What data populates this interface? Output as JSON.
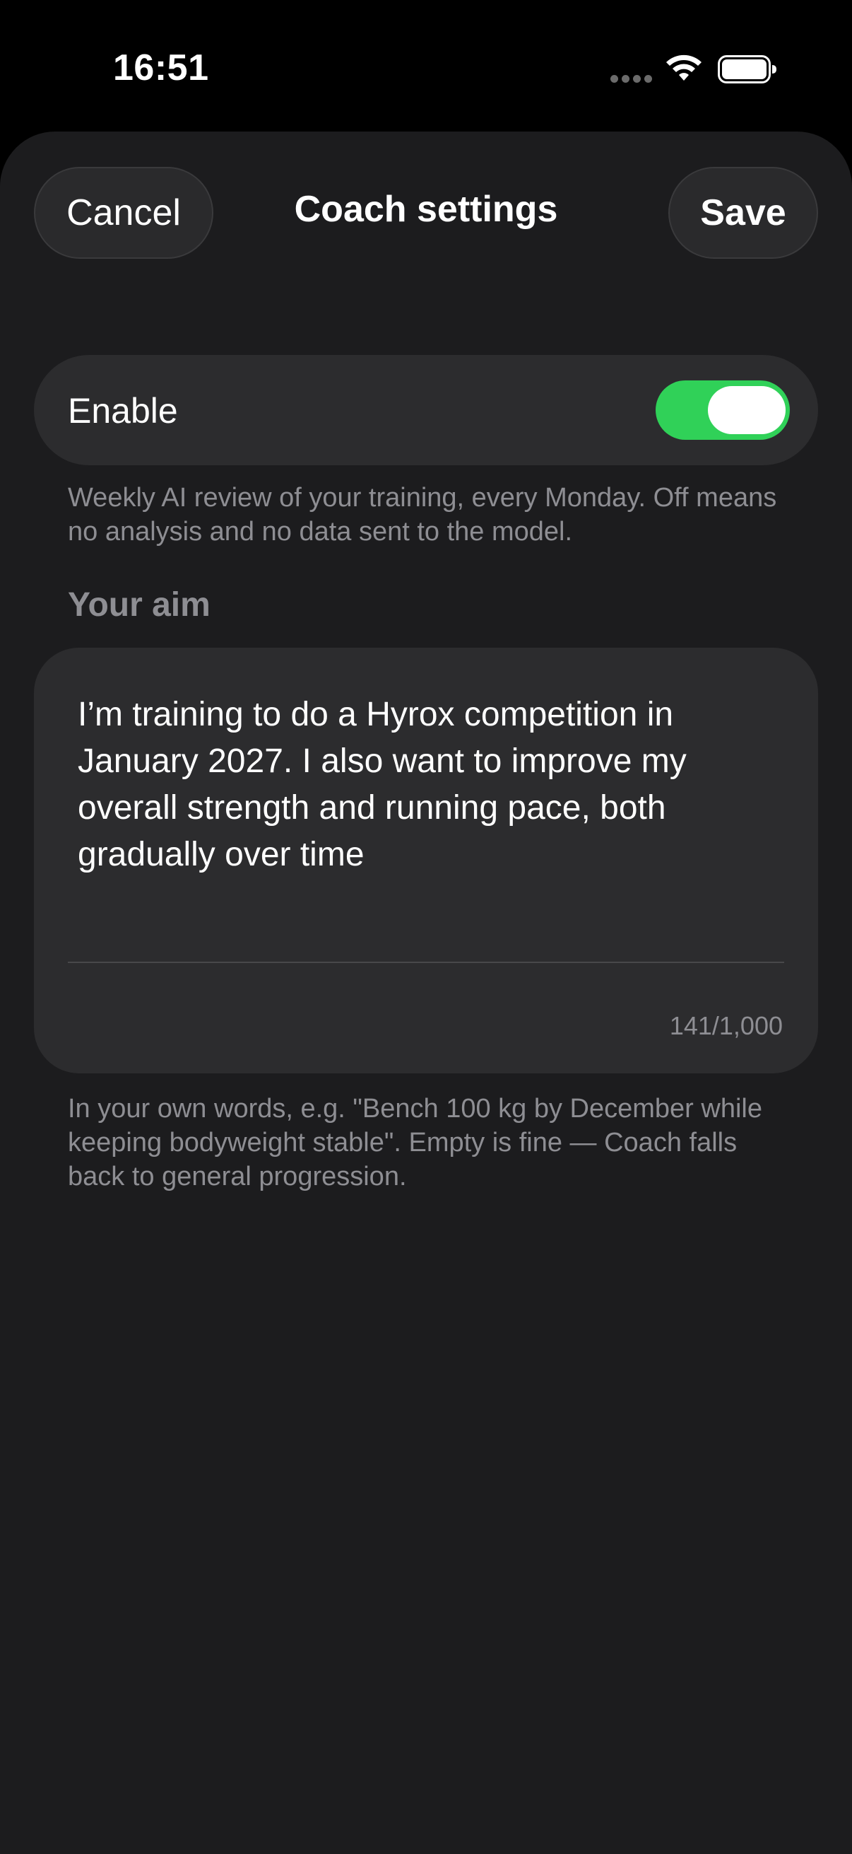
{
  "status_bar": {
    "time": "16:51",
    "icons": [
      "signal-dots-icon",
      "wifi-icon",
      "battery-icon"
    ]
  },
  "header": {
    "cancel_label": "Cancel",
    "title": "Coach settings",
    "save_label": "Save"
  },
  "enable": {
    "label": "Enable",
    "on": true,
    "accent_color": "#30d158",
    "description": "Weekly AI review of your training, every Monday. Off means no analysis and no data sent to the model."
  },
  "aim": {
    "section_label": "Your aim",
    "value": "I’m training to do a Hyrox competition in January 2027. I also want to improve my overall strength and running pace, both gradually over time",
    "counter": "141/1,000",
    "hint": "In your own words, e.g. \"Bench 100 kg by December while keeping bodyweight stable\". Empty is fine — Coach falls back to general progression."
  }
}
